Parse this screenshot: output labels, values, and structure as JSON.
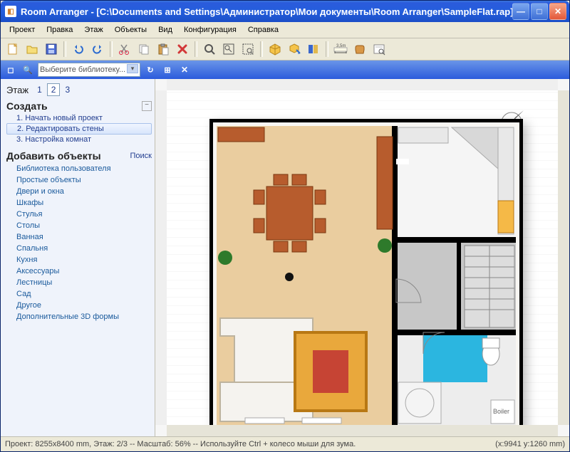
{
  "title": "Room Arranger - [C:\\Documents and Settings\\Администратор\\Мои документы\\Room Arranger\\SampleFlat.rap] - НЕ ЗАРЕГИСТРИРО...",
  "menus": [
    "Проект",
    "Правка",
    "Этаж",
    "Объекты",
    "Вид",
    "Конфигурация",
    "Справка"
  ],
  "search_placeholder": "Выберите библиотеку...",
  "sidebar": {
    "floor_label": "Этаж",
    "floors": [
      "1",
      "2",
      "3"
    ],
    "create_head": "Создать",
    "create_items": [
      "1. Начать новый проект",
      "2. Редактировать стены",
      "3. Настройка комнат"
    ],
    "add_head": "Добавить объекты",
    "search_link": "Поиск",
    "categories": [
      "Библиотека пользователя",
      "Простые объекты",
      "Двери и окна",
      "Шкафы",
      "Стулья",
      "Столы",
      "Ванная",
      "Спальня",
      "Кухня",
      "Аксессуары",
      "Лестницы",
      "Сад",
      "Другое",
      "Дополнительные 3D формы"
    ]
  },
  "status_left": "Проект: 8255x8400 mm, Этаж: 2/3 -- Масштаб: 56% -- Используйте Ctrl + колесо мыши для зума.",
  "status_right": "(x:9941 y:1260 mm)"
}
